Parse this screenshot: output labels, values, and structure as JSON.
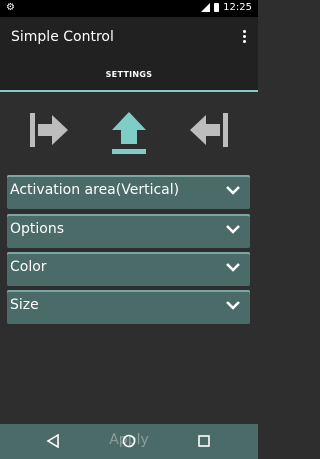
{
  "status_bar": {
    "time": "12:25"
  },
  "app_bar": {
    "title": "Simple Control"
  },
  "tabs": [
    {
      "label": "SETTINGS"
    }
  ],
  "position_icons": [
    "align-left-icon",
    "align-bottom-icon",
    "align-right-icon"
  ],
  "panels": [
    {
      "label": "Activation area(Vertical)"
    },
    {
      "label": "Options"
    },
    {
      "label": "Color"
    },
    {
      "label": "Size"
    }
  ],
  "apply_button": {
    "label": "Apply"
  },
  "colors": {
    "accent": "#7ecdc6",
    "panel": "#4b6b68",
    "background": "#2e2e2e",
    "appbar": "#212121",
    "inactive_icon": "#bdbdbd"
  }
}
